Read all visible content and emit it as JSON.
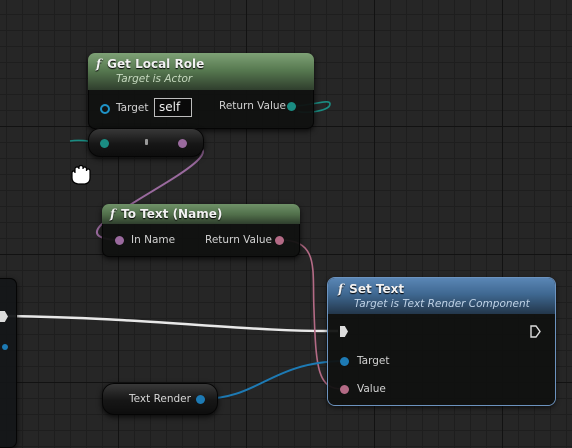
{
  "graph": {
    "get_local_role": {
      "title": "Get Local Role",
      "subtitle": "Target is Actor",
      "function_icon": "f",
      "target_label": "Target",
      "target_value": "self",
      "return_label": "Return Value"
    },
    "to_text": {
      "title": "To Text (Name)",
      "function_icon": "f",
      "input_label": "In Name",
      "return_label": "Return Value"
    },
    "set_text": {
      "title": "Set Text",
      "subtitle": "Target is Text Render Component",
      "function_icon": "f",
      "target_label": "Target",
      "value_label": "Value"
    },
    "text_render_var": {
      "label": "Text Render"
    }
  },
  "colors": {
    "function_header_green": "#55744d",
    "function_header_blue": "#3f6891",
    "name_pin": "#9a6a9e",
    "text_pin": "#b36a85",
    "object_pin": "#1d7ab4",
    "enum_pin": "#1a8c82",
    "exec_wire": "#e8e8e8"
  },
  "icons": [
    "function-icon",
    "exec-pin-icon",
    "grab-hand-cursor-icon"
  ]
}
